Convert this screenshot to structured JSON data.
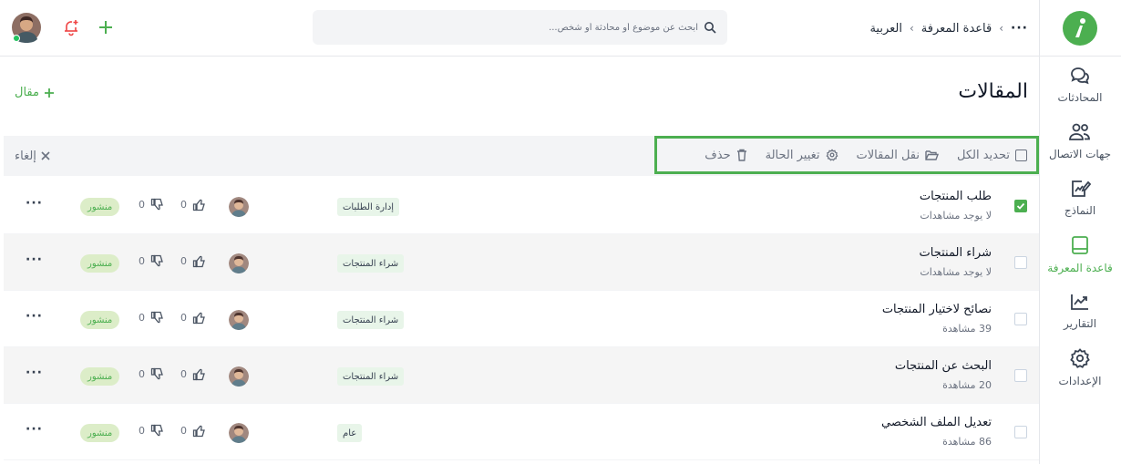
{
  "sidebar": {
    "items": [
      {
        "label": "المحادثات",
        "icon": "chat-icon"
      },
      {
        "label": "جهات الاتصال",
        "icon": "contacts-icon"
      },
      {
        "label": "النماذج",
        "icon": "forms-icon"
      },
      {
        "label": "قاعدة المعرفة",
        "icon": "book-icon"
      },
      {
        "label": "التقارير",
        "icon": "chart-icon"
      },
      {
        "label": "الإعدادات",
        "icon": "gear-icon"
      }
    ],
    "active": "قاعدة المعرفة"
  },
  "header": {
    "breadcrumb": [
      "العربية",
      "قاعدة المعرفة"
    ],
    "search_placeholder": "ابحث عن موضوع أو محادثة أو شخص..."
  },
  "page": {
    "title": "المقالات",
    "add_article": "مقال"
  },
  "bulk": {
    "select_all": "تحديد الكل",
    "move": "نقل المقالات",
    "change_status": "تغيير الحالة",
    "delete": "حذف",
    "cancel": "إلغاء"
  },
  "articles": [
    {
      "title": "طلب المنتجات",
      "views": "لا يوجد مشاهدات",
      "category": "إدارة الطلبات",
      "likes": "0",
      "dislikes": "0",
      "status": "منشور",
      "checked": true
    },
    {
      "title": "شراء المنتجات",
      "views": "لا يوجد مشاهدات",
      "category": "شراء المنتجات",
      "likes": "0",
      "dislikes": "0",
      "status": "منشور",
      "checked": false
    },
    {
      "title": "نصائح لاختيار المنتجات",
      "views": "39 مشاهدة",
      "category": "شراء المنتجات",
      "likes": "0",
      "dislikes": "0",
      "status": "منشور",
      "checked": false
    },
    {
      "title": "البحث عن المنتجات",
      "views": "20 مشاهدة",
      "category": "شراء المنتجات",
      "likes": "0",
      "dislikes": "0",
      "status": "منشور",
      "checked": false
    },
    {
      "title": "تعديل الملف الشخصي",
      "views": "86 مشاهدة",
      "category": "عام",
      "likes": "0",
      "dislikes": "0",
      "status": "منشور",
      "checked": false
    }
  ],
  "colors": {
    "accent": "#4caf50",
    "tag_bg": "#e8f5e9",
    "status_bg": "#dcedc8",
    "alt_row": "#f5f5f5"
  }
}
